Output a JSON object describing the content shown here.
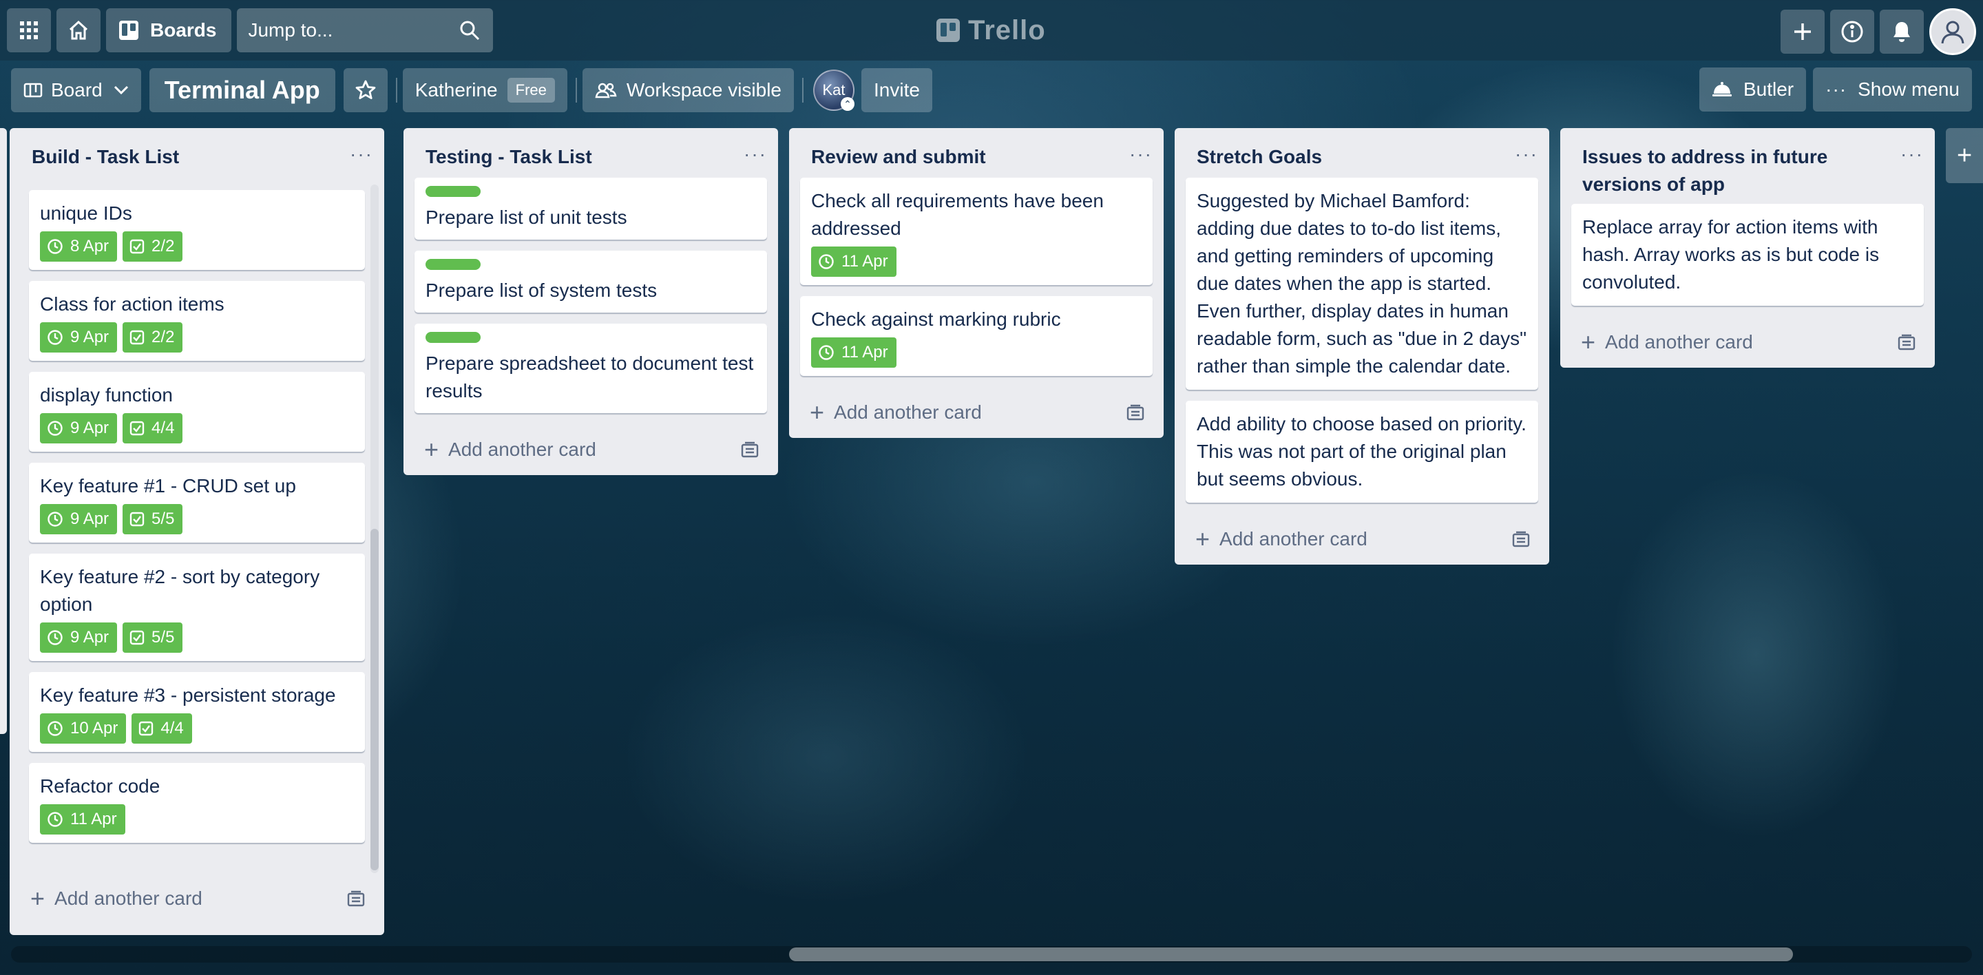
{
  "header": {
    "boards_label": "Boards",
    "search_placeholder": "Jump to...",
    "logo_text": "Trello"
  },
  "board": {
    "view_label": "Board",
    "title": "Terminal App",
    "workspace_name": "Katherine",
    "plan_badge": "Free",
    "visibility_label": "Workspace visible",
    "member_avatar_initials": "Kat",
    "invite_label": "Invite",
    "butler_label": "Butler",
    "show_menu_label": "Show menu"
  },
  "add_card_label": "Add another card",
  "lists": [
    {
      "title": "Build - Task List",
      "cards": [
        {
          "title": "unique IDs",
          "due": "8 Apr",
          "checklist": "2/2"
        },
        {
          "title": "Class for action items",
          "due": "9 Apr",
          "checklist": "2/2"
        },
        {
          "title": "display function",
          "due": "9 Apr",
          "checklist": "4/4"
        },
        {
          "title": "Key feature #1 - CRUD set up",
          "due": "9 Apr",
          "checklist": "5/5"
        },
        {
          "title": "Key feature #2 - sort by category option",
          "due": "9 Apr",
          "checklist": "5/5"
        },
        {
          "title": "Key feature #3 - persistent storage",
          "due": "10 Apr",
          "checklist": "4/4"
        },
        {
          "title": "Refactor code",
          "due": "11 Apr"
        }
      ]
    },
    {
      "title": "Testing - Task List",
      "cards": [
        {
          "title": "Prepare list of unit tests",
          "label_color": "#61bd4f"
        },
        {
          "title": "Prepare list of system tests",
          "label_color": "#61bd4f"
        },
        {
          "title": "Prepare spreadsheet to document test results",
          "label_color": "#61bd4f"
        }
      ]
    },
    {
      "title": "Review and submit",
      "cards": [
        {
          "title": "Check all requirements have been addressed",
          "due": "11 Apr"
        },
        {
          "title": "Check against marking rubric",
          "due": "11 Apr"
        }
      ]
    },
    {
      "title": "Stretch Goals",
      "cards": [
        {
          "title": "Suggested by Michael Bamford: adding due dates to to-do list items, and getting reminders of upcoming due dates when the app is started. Even further, display dates in human readable form, such as \"due in 2 days\" rather than simple the calendar date."
        },
        {
          "title": "Add ability to choose based on priority. This was not part of the original plan but seems obvious."
        }
      ]
    },
    {
      "title": "Issues to address in future versions of app",
      "cards": [
        {
          "title": "Replace array for action items with hash. Array works as is but code is convoluted."
        }
      ]
    }
  ],
  "colors": {
    "due_badge": "#61bd4f",
    "list_bg": "#ebecf0",
    "card_text": "#172b4d"
  },
  "icons": [
    "apps-icon",
    "home-icon",
    "boards-icon",
    "search-icon",
    "plus-icon",
    "info-icon",
    "bell-icon",
    "user-icon",
    "star-icon",
    "people-icon",
    "clock-icon",
    "checklist-icon",
    "template-icon"
  ]
}
